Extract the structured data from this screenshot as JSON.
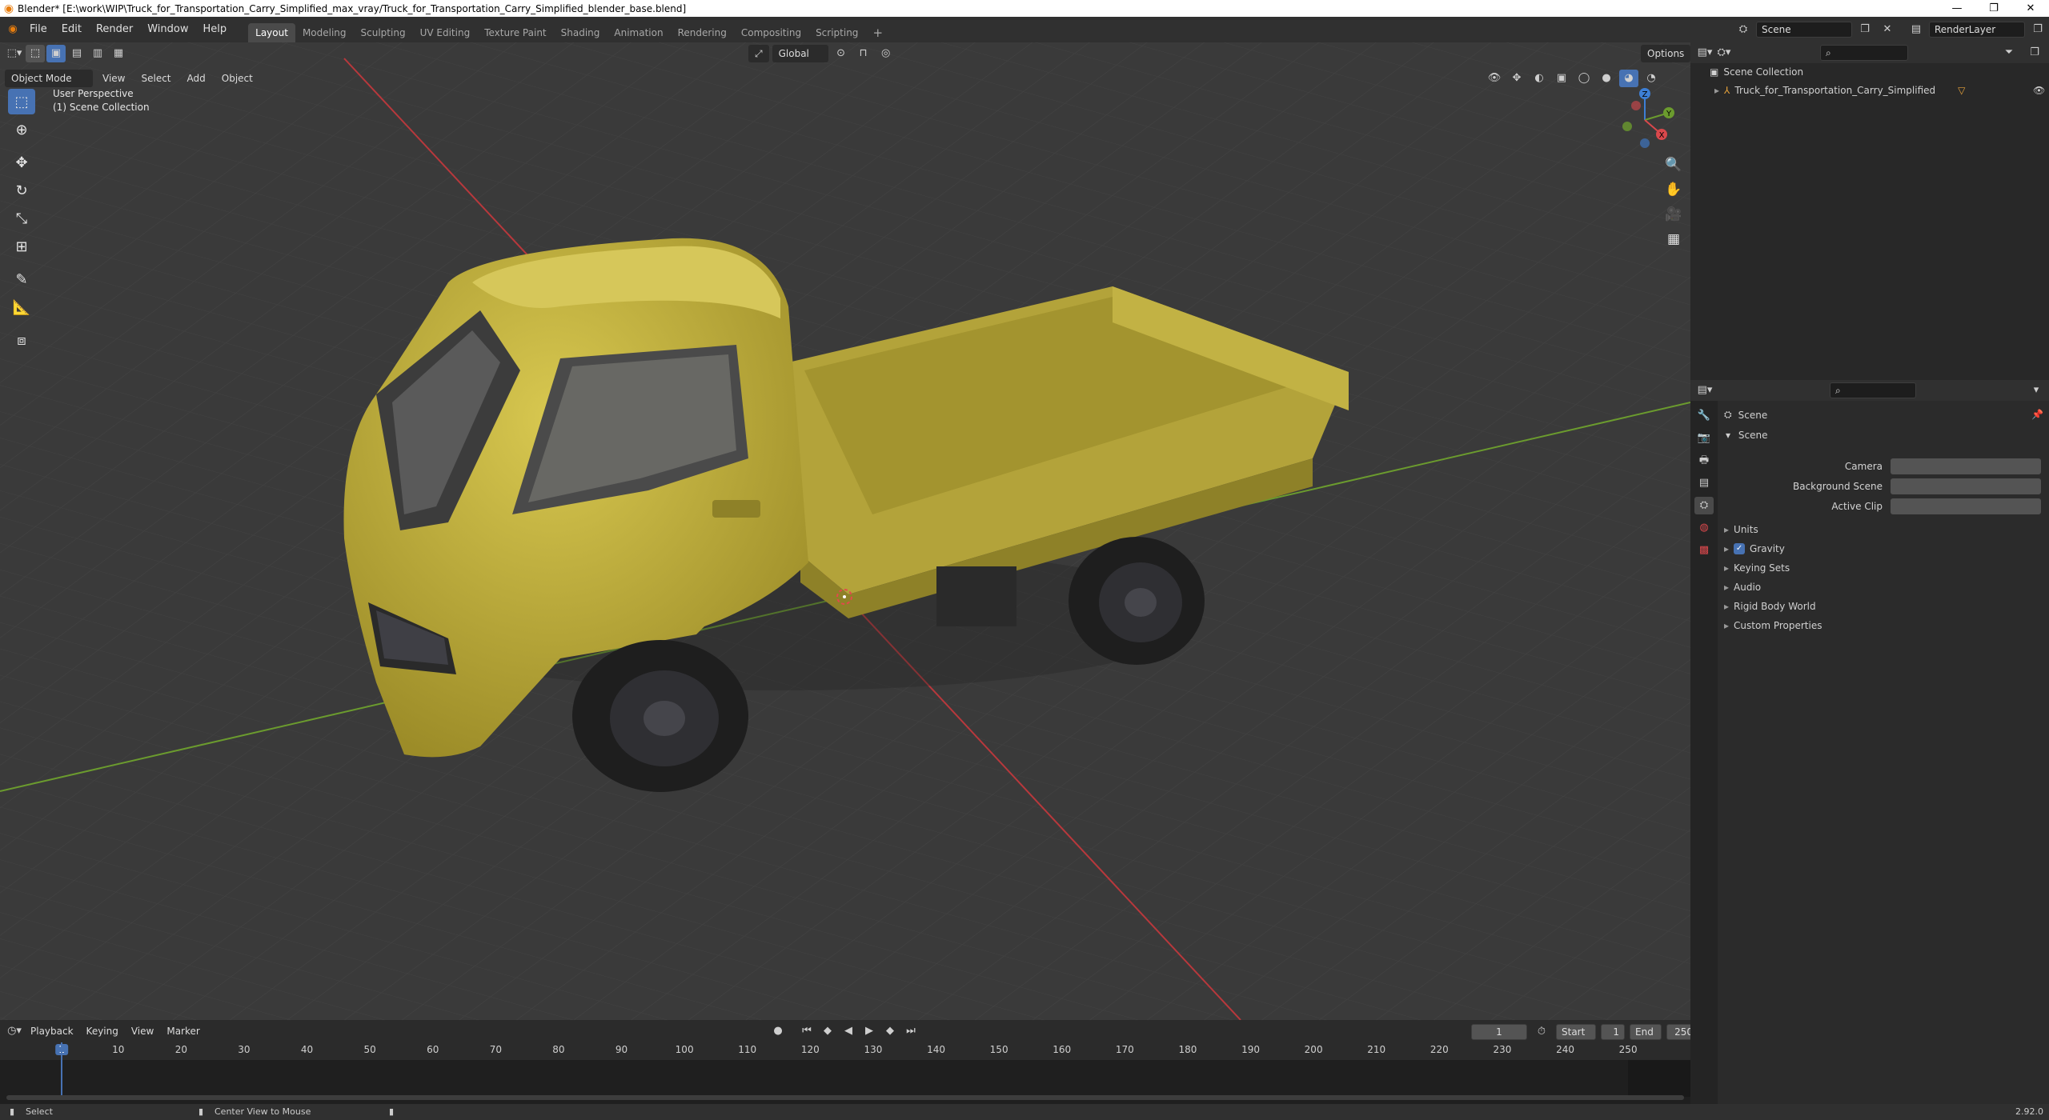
{
  "window": {
    "title": "Blender* [E:\\work\\WIP\\Truck_for_Transportation_Carry_Simplified_max_vray/Truck_for_Transportation_Carry_Simplified_blender_base.blend]",
    "minimize": "—",
    "maximize": "❐",
    "close": "✕"
  },
  "menu": [
    "File",
    "Edit",
    "Render",
    "Window",
    "Help"
  ],
  "workspaces": [
    "Layout",
    "Modeling",
    "Sculpting",
    "UV Editing",
    "Texture Paint",
    "Shading",
    "Animation",
    "Rendering",
    "Compositing",
    "Scripting"
  ],
  "workspace_add": "+",
  "scene_selector": "Scene",
  "viewlayer_selector": "RenderLayer",
  "viewport": {
    "mode": "Object Mode",
    "menus": [
      "View",
      "Select",
      "Add",
      "Object"
    ],
    "transform_orientation": "Global",
    "options_button": "Options",
    "overlay_title": "User Perspective",
    "overlay_subtitle": "(1) Scene Collection",
    "gizmo": {
      "x": "X",
      "y": "Y",
      "z": "Z"
    }
  },
  "tools": [
    "select-box",
    "cursor",
    "move",
    "rotate",
    "scale",
    "transform",
    "annotate",
    "measure",
    "add-cube"
  ],
  "nav_gizmos": [
    "zoom",
    "pan",
    "camera",
    "perspective"
  ],
  "timeline": {
    "menus": [
      "Playback",
      "Keying",
      "View",
      "Marker"
    ],
    "current_frame": "1",
    "start_label": "Start",
    "start_value": "1",
    "end_label": "End",
    "end_value": "250",
    "ruler_ticks": [
      "1",
      "10",
      "20",
      "30",
      "40",
      "50",
      "60",
      "70",
      "80",
      "90",
      "100",
      "110",
      "120",
      "130",
      "140",
      "150",
      "160",
      "170",
      "180",
      "190",
      "200",
      "210",
      "220",
      "230",
      "240",
      "250"
    ]
  },
  "outliner": {
    "root": "Scene Collection",
    "items": [
      {
        "label": "Truck_for_Transportation_Carry_Simplified",
        "type": "empty"
      }
    ]
  },
  "properties": {
    "header": "Scene",
    "panel_title": "Scene",
    "fields": [
      {
        "label": "Camera",
        "value": ""
      },
      {
        "label": "Background Scene",
        "value": ""
      },
      {
        "label": "Active Clip",
        "value": ""
      }
    ],
    "sections": [
      {
        "label": "Units",
        "checkbox": false
      },
      {
        "label": "Gravity",
        "checkbox": true
      },
      {
        "label": "Keying Sets",
        "checkbox": false
      },
      {
        "label": "Audio",
        "checkbox": false
      },
      {
        "label": "Rigid Body World",
        "checkbox": false
      },
      {
        "label": "Custom Properties",
        "checkbox": false
      }
    ]
  },
  "statusbar": {
    "left": "Select",
    "middle": "Center View to Mouse",
    "version": "2.92.0"
  },
  "colors": {
    "accent": "#4772b3",
    "truck": "#c9b83f",
    "x_axis": "#d9484c",
    "y_axis": "#6b9b2e",
    "z_axis": "#3d7fd6"
  }
}
